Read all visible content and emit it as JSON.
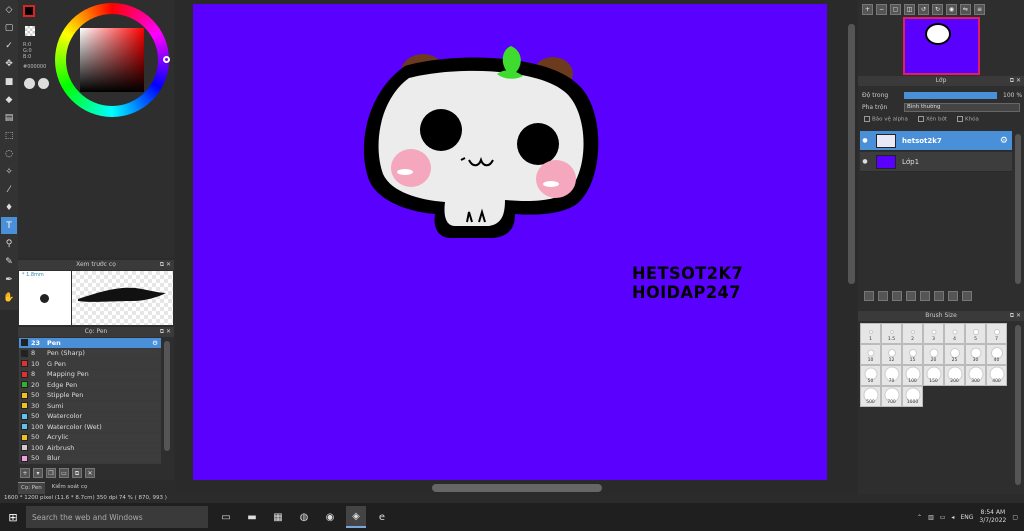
{
  "toolbar": {
    "tools": [
      "eraser-icon",
      "eraser-icon",
      "select-rect-icon",
      "pen-check-icon",
      "move-icon",
      "fill-icon",
      "bucket-icon",
      "gradient-icon",
      "lasso-icon",
      "select-icon",
      "magic-wand-icon",
      "eyedropper-icon",
      "brush-icon",
      "stamp-icon",
      "text-icon",
      "shape-icon",
      "pen-icon",
      "hand-icon",
      "pan-icon"
    ]
  },
  "color": {
    "r": "R:0",
    "g": "G:0",
    "b": "B:0",
    "hex": "#000000"
  },
  "brush_preview": {
    "title": "Xem trước cọ",
    "size_label": "* 1.8mm"
  },
  "brush_list": {
    "title": "Cọ: Pen",
    "items": [
      {
        "size": "23",
        "name": "Pen",
        "color": "#222222"
      },
      {
        "size": "8",
        "name": "Pen (Sharp)",
        "color": "#222222"
      },
      {
        "size": "10",
        "name": "G Pen",
        "color": "#e03030"
      },
      {
        "size": "8",
        "name": "Mapping Pen",
        "color": "#e03030"
      },
      {
        "size": "20",
        "name": "Edge Pen",
        "color": "#30b030"
      },
      {
        "size": "50",
        "name": "Stipple Pen",
        "color": "#f0c020"
      },
      {
        "size": "30",
        "name": "Sumi",
        "color": "#f0c020"
      },
      {
        "size": "50",
        "name": "Watercolor",
        "color": "#60c0f0"
      },
      {
        "size": "100",
        "name": "Watercolor (Wet)",
        "color": "#60c0f0"
      },
      {
        "size": "50",
        "name": "Acrylic",
        "color": "#f0c020"
      },
      {
        "size": "100",
        "name": "Airbrush",
        "color": "#cccccc"
      },
      {
        "size": "50",
        "name": "Blur",
        "color": "#f0a0e0"
      }
    ]
  },
  "bottom_tabs": [
    "Cọ: Pen",
    "Kiểm soát cọ"
  ],
  "canvas": {
    "bg_color": "#5a00fe",
    "watermark_line1": "HETSOT2K7",
    "watermark_line2": "HOIDAP247"
  },
  "layers": {
    "title": "Lớp",
    "opacity_label": "Độ trong",
    "opacity_value": "100 %",
    "opacity": 1.0,
    "blend_label": "Pha trộn",
    "blend_value": "Bình thường",
    "check_alpha": "Bảo vệ alpha",
    "check_clip": "Xén bớt",
    "check_lock": "Khóa",
    "items": [
      {
        "name": "hetsot2k7",
        "selected": true
      },
      {
        "name": "Lớp1",
        "selected": false
      }
    ]
  },
  "brush_size": {
    "title": "Brush Size",
    "sizes": [
      "1",
      "1.5",
      "2",
      "3",
      "4",
      "5",
      "7",
      "10",
      "12",
      "15",
      "20",
      "25",
      "30",
      "40",
      "50",
      "70",
      "100",
      "150",
      "200",
      "300",
      "400",
      "500",
      "700",
      "1000"
    ]
  },
  "status": {
    "text": "1600 * 1200 pixel  (11.6 * 8.7cm)  350 dpi  74 %  ( 870, 993 )"
  },
  "taskbar": {
    "search_placeholder": "Search the web and Windows",
    "lang": "ENG",
    "time": "8:54 AM",
    "date": "3/7/2022"
  }
}
